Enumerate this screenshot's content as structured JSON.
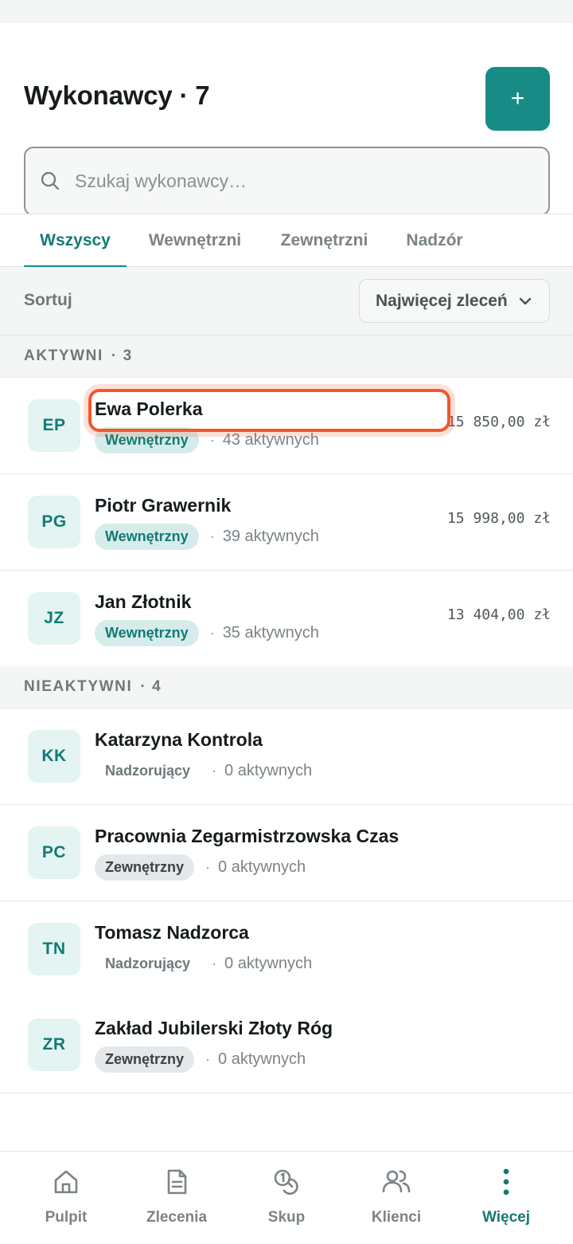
{
  "header": {
    "title": "Wykonawcy · 7",
    "add_label": "+"
  },
  "search": {
    "placeholder": "Szukaj wykonawcy…",
    "value": ""
  },
  "tabs": [
    {
      "label": "Wszyscy",
      "active": true
    },
    {
      "label": "Wewnętrzni",
      "active": false
    },
    {
      "label": "Zewnętrzni",
      "active": false
    },
    {
      "label": "Nadzór",
      "active": false
    }
  ],
  "sort": {
    "label": "Sortuj",
    "selected": "Najwięcej zleceń"
  },
  "sections": [
    {
      "title": "AKTYWNI",
      "count": "· 3",
      "items": [
        {
          "initials": "EP",
          "name": "Ewa Polerka",
          "type": "Wewnętrzny",
          "active": "43 aktywnych",
          "amount": "15 850,00 zł"
        },
        {
          "initials": "PG",
          "name": "Piotr Grawernik",
          "type": "Wewnętrzny",
          "active": "39 aktywnych",
          "amount": "15 998,00 zł"
        },
        {
          "initials": "JZ",
          "name": "Jan Złotnik",
          "type": "Wewnętrzny",
          "active": "35 aktywnych",
          "amount": "13 404,00 zł"
        }
      ]
    },
    {
      "title": "NIEAKTYWNI",
      "count": "· 4",
      "items": [
        {
          "initials": "KK",
          "name": "Katarzyna Kontrola",
          "type": "Nadzorujący",
          "active": "0 aktywnych"
        },
        {
          "initials": "PC",
          "name": "Pracownia Zegarmistrzowska Czas",
          "type": "Zewnętrzny",
          "active": "0 aktywnych"
        },
        {
          "initials": "TN",
          "name": "Tomasz Nadzorca",
          "type": "Nadzorujący",
          "active": "0 aktywnych"
        },
        {
          "initials": "ZR",
          "name": "Zakład Jubilerski Złoty Róg",
          "type": "Zewnętrzny",
          "active": "0 aktywnych"
        }
      ]
    }
  ],
  "dot_separator": "·",
  "bottom_nav": [
    {
      "label": "Pulpit",
      "icon": "home-icon",
      "active": false
    },
    {
      "label": "Zlecenia",
      "icon": "document-icon",
      "active": false
    },
    {
      "label": "Skup",
      "icon": "coins-icon",
      "active": false
    },
    {
      "label": "Klienci",
      "icon": "users-icon",
      "active": false
    },
    {
      "label": "Więcej",
      "icon": "more-vertical-icon",
      "active": true
    }
  ],
  "colors": {
    "accent": "#178c86",
    "accent_text": "#137a75",
    "highlight": "#f0582a"
  }
}
